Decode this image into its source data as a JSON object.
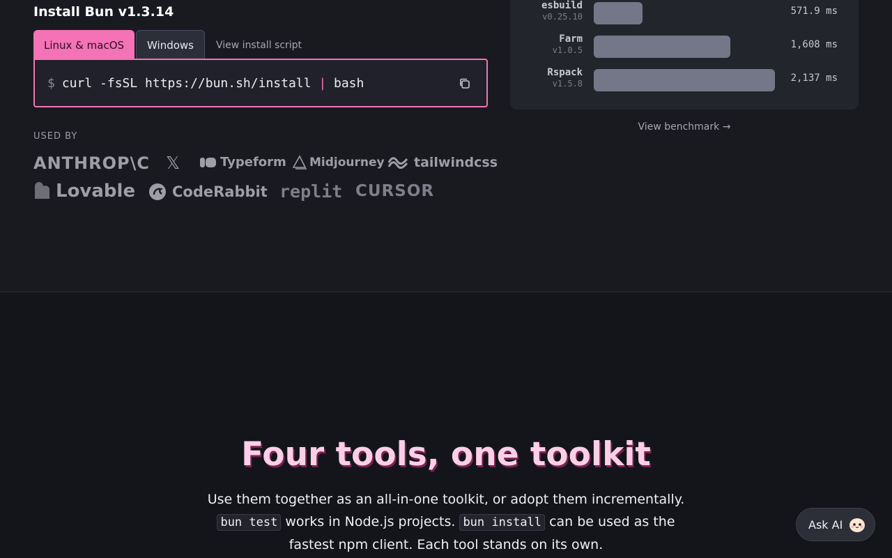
{
  "install": {
    "title": "Install Bun v1.3.14",
    "tabs": [
      "Linux & macOS",
      "Windows"
    ],
    "view_script": "View install script",
    "command_prompt": "$",
    "command_main": "curl -fsSL https://bun.sh/install",
    "command_pipe": "|",
    "command_tail": "bash"
  },
  "used_by": {
    "label": "USED BY",
    "logos": [
      "ANTHROP\\C",
      "𝕏",
      "Typeform",
      "Midjourney",
      "tailwindcss",
      "Lovable",
      "CodeRabbit",
      "replit",
      "CURSOR"
    ]
  },
  "benchmark": {
    "rows": [
      {
        "name": "esbuild",
        "version": "v0.25.10",
        "value": "571.9 ms",
        "ms": 571.9
      },
      {
        "name": "Farm",
        "version": "v1.0.5",
        "value": "1,608 ms",
        "ms": 1608
      },
      {
        "name": "Rspack",
        "version": "v1.5.8",
        "value": "2,137 ms",
        "ms": 2137
      }
    ],
    "link": "View benchmark →"
  },
  "hero": {
    "title": "Four tools, one toolkit",
    "line1": "Use them together as an all-in-one toolkit, or adopt them incrementally.",
    "code1": "bun test",
    "mid1": " works in Node.js projects. ",
    "code2": "bun install",
    "mid2": " can be used as the fastest npm client. Each tool stands on its own."
  },
  "ask_ai": {
    "label": "Ask AI"
  },
  "colors": {
    "accent": "#f472b6",
    "background": "#14151a",
    "bar": "#747787"
  }
}
